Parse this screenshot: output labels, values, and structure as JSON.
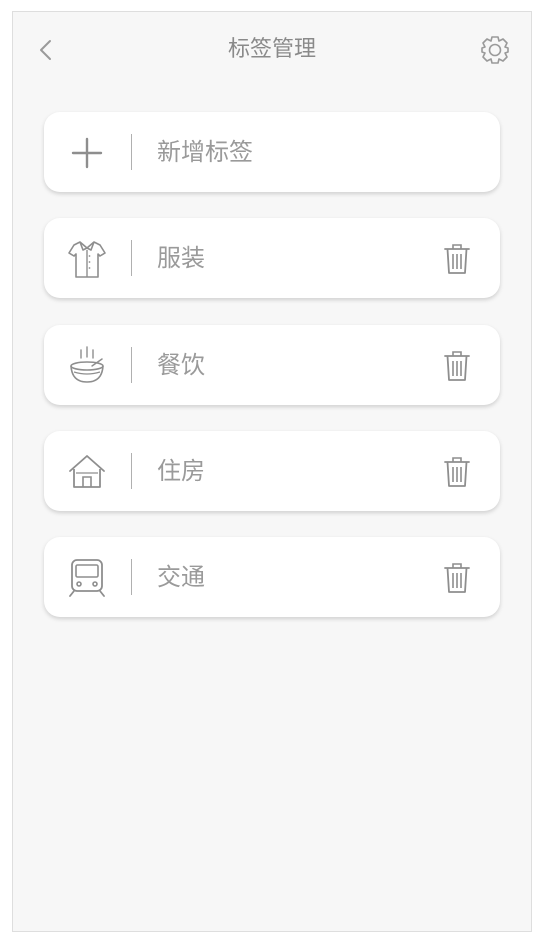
{
  "header": {
    "title": "标签管理",
    "back_icon": "chevron-left-icon",
    "settings_icon": "gear-icon"
  },
  "add_card": {
    "label": "新增标签",
    "icon": "plus-icon"
  },
  "tags": [
    {
      "label": "服装",
      "icon": "shirt-icon"
    },
    {
      "label": "餐饮",
      "icon": "bowl-icon"
    },
    {
      "label": "住房",
      "icon": "house-icon"
    },
    {
      "label": "交通",
      "icon": "train-icon"
    }
  ],
  "colors": {
    "background": "#f7f7f7",
    "card": "#ffffff",
    "text": "#9a9a9a",
    "icon": "#8e8e8e"
  }
}
